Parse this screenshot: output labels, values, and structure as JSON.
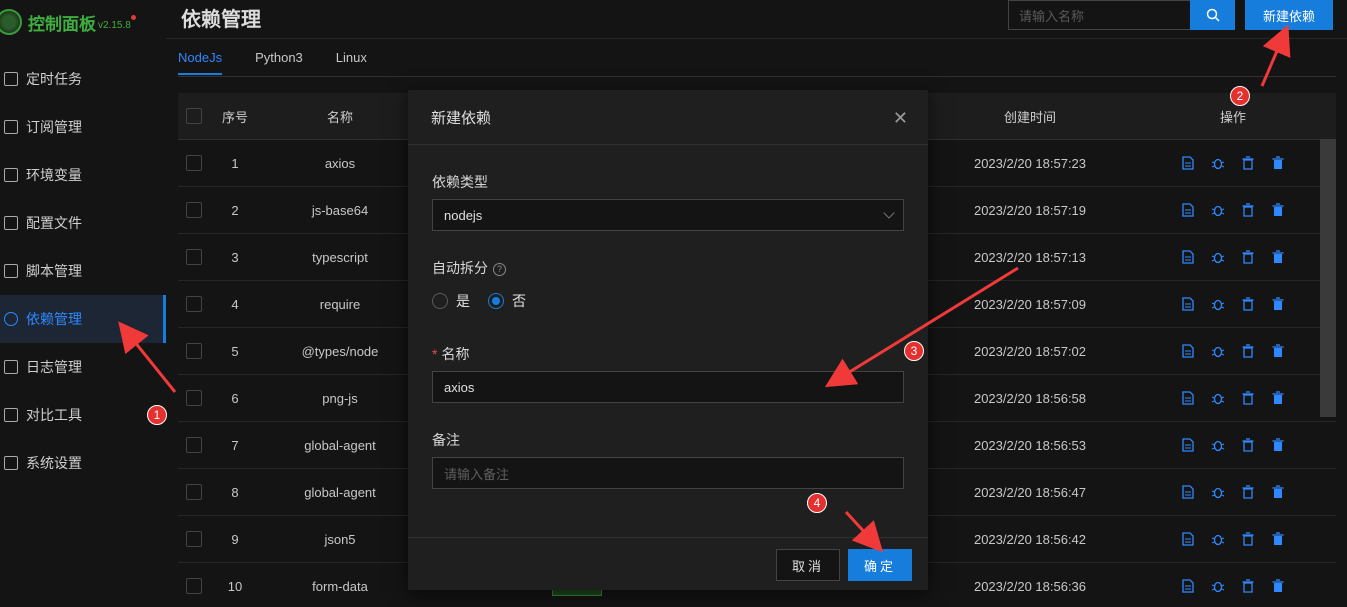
{
  "app": {
    "name": "控制面板",
    "version": "v2.15.8"
  },
  "sidebar": {
    "items": [
      {
        "label": "定时任务"
      },
      {
        "label": "订阅管理"
      },
      {
        "label": "环境变量"
      },
      {
        "label": "配置文件"
      },
      {
        "label": "脚本管理"
      },
      {
        "label": "依赖管理",
        "active": true
      },
      {
        "label": "日志管理"
      },
      {
        "label": "对比工具"
      },
      {
        "label": "系统设置"
      }
    ]
  },
  "header": {
    "title": "依赖管理",
    "search_placeholder": "请输入名称",
    "new_button": "新建依赖"
  },
  "tabs": [
    "NodeJs",
    "Python3",
    "Linux"
  ],
  "table": {
    "headers": {
      "index": "序号",
      "name": "名称",
      "time": "创建时间",
      "ops": "操作"
    },
    "rows": [
      {
        "index": "1",
        "name": "axios",
        "time": "2023/2/20 18:57:23"
      },
      {
        "index": "2",
        "name": "js-base64",
        "time": "2023/2/20 18:57:19"
      },
      {
        "index": "3",
        "name": "typescript",
        "time": "2023/2/20 18:57:13"
      },
      {
        "index": "4",
        "name": "require",
        "time": "2023/2/20 18:57:09"
      },
      {
        "index": "5",
        "name": "@types/node",
        "time": "2023/2/20 18:57:02"
      },
      {
        "index": "6",
        "name": "png-js",
        "time": "2023/2/20 18:56:58"
      },
      {
        "index": "7",
        "name": "global-agent",
        "time": "2023/2/20 18:56:53"
      },
      {
        "index": "8",
        "name": "global-agent",
        "time": "2023/2/20 18:56:47"
      },
      {
        "index": "9",
        "name": "json5",
        "time": "2023/2/20 18:56:42"
      },
      {
        "index": "10",
        "name": "form-data",
        "time": "2023/2/20 18:56:36"
      }
    ]
  },
  "modal": {
    "title": "新建依赖",
    "type_label": "依赖类型",
    "type_value": "nodejs",
    "auto_split_label": "自动拆分",
    "radio_yes": "是",
    "radio_no": "否",
    "name_label": "名称",
    "name_value": "axios",
    "remark_label": "备注",
    "remark_placeholder": "请输入备注",
    "cancel": "取消",
    "ok": "确定"
  },
  "annotations": [
    "1",
    "2",
    "3",
    "4"
  ],
  "colors": {
    "accent": "#177ddc",
    "annotation": "#e53030",
    "brand": "#3eaf3e"
  }
}
